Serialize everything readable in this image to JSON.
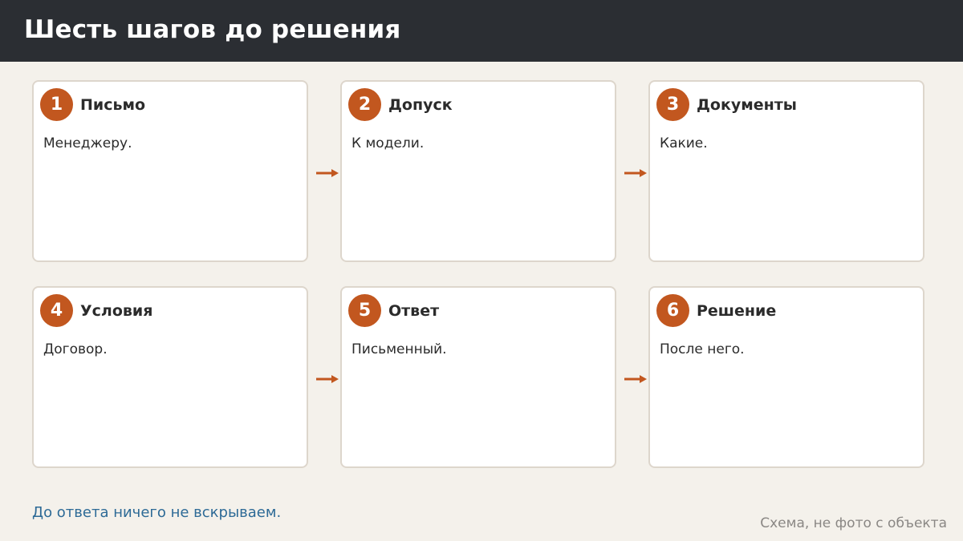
{
  "header": {
    "title": "Шесть шагов до решения"
  },
  "steps": [
    {
      "number": "1",
      "title": "Письмо",
      "text": "Менеджеру."
    },
    {
      "number": "2",
      "title": "Допуск",
      "text": "К модели."
    },
    {
      "number": "3",
      "title": "Документы",
      "text": "Какие."
    },
    {
      "number": "4",
      "title": "Условия",
      "text": "Договор."
    },
    {
      "number": "5",
      "title": "Ответ",
      "text": "Письменный."
    },
    {
      "number": "6",
      "title": "Решение",
      "text": "После него."
    }
  ],
  "footer": {
    "note": "До ответа ничего не вскрываем.",
    "caption": "Схема, не фото с объекта"
  },
  "colors": {
    "accent": "#c2571f",
    "header_bg": "#2b2e33",
    "note": "#2d6a96"
  }
}
